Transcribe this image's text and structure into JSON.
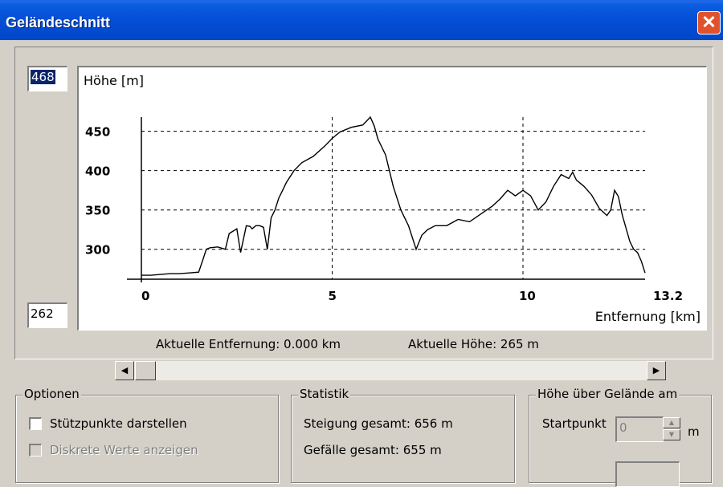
{
  "window": {
    "title": "Geländeschnitt",
    "close_label": "✕"
  },
  "range": {
    "max_value": "468",
    "min_value": "262"
  },
  "chart_data": {
    "type": "line",
    "ylabel": "Höhe [m]",
    "xlabel": "Entfernung [km]",
    "xlim": [
      0,
      13.2
    ],
    "ylim": [
      262,
      468
    ],
    "xticks": [
      "0",
      "5",
      "10",
      "13.2"
    ],
    "xtick_values": [
      0,
      5,
      10,
      13.2
    ],
    "yticks": [
      "300",
      "350",
      "400",
      "450"
    ],
    "ytick_values": [
      300,
      350,
      400,
      450
    ],
    "grid": true,
    "series": [
      {
        "x": [
          0,
          0.25,
          0.5,
          0.75,
          1,
          1.25,
          1.5,
          1.6,
          1.7,
          1.8,
          2,
          2.2,
          2.3,
          2.5,
          2.6,
          2.75,
          2.85,
          2.9,
          3.0,
          3.1,
          3.2,
          3.3,
          3.4,
          3.5,
          3.6,
          3.7,
          3.8,
          4.0,
          4.2,
          4.5,
          4.8,
          5.0,
          5.2,
          5.5,
          5.8,
          6.0,
          6.1,
          6.2,
          6.4,
          6.6,
          6.8,
          7.0,
          7.2,
          7.35,
          7.5,
          7.7,
          8.0,
          8.3,
          8.6,
          8.9,
          9.2,
          9.4,
          9.6,
          9.8,
          10.0,
          10.2,
          10.4,
          10.6,
          10.8,
          11.0,
          11.2,
          11.3,
          11.4,
          11.6,
          11.8,
          12.0,
          12.2,
          12.3,
          12.4,
          12.5,
          12.6,
          12.8,
          12.9,
          13.0,
          13.1,
          13.2
        ],
        "y": [
          267,
          267,
          268,
          269,
          269,
          270,
          271,
          285,
          300,
          302,
          303,
          300,
          320,
          326,
          296,
          330,
          329,
          326,
          330,
          330,
          328,
          300,
          340,
          350,
          365,
          375,
          385,
          400,
          410,
          418,
          431,
          441,
          449,
          455,
          458,
          468,
          457,
          440,
          420,
          380,
          350,
          330,
          300,
          318,
          325,
          330,
          330,
          338,
          335,
          345,
          355,
          364,
          375,
          368,
          375,
          368,
          350,
          360,
          380,
          395,
          390,
          398,
          388,
          380,
          369,
          352,
          343,
          350,
          375,
          367,
          344,
          310,
          300,
          296,
          285,
          270
        ]
      }
    ]
  },
  "readouts": {
    "distance": "Aktuelle Entfernung: 0.000 km",
    "height": "Aktuelle Höhe: 265 m"
  },
  "options": {
    "legend": "Optionen",
    "show_support_points": "Stützpunkte darstellen",
    "show_discrete_values": "Diskrete Werte anzeigen"
  },
  "statistics": {
    "legend": "Statistik",
    "ascent": "Steigung gesamt: 656 m",
    "descent": "Gefälle gesamt: 655 m"
  },
  "height_above_terrain": {
    "legend": "Höhe über Gelände am",
    "start_label": "Startpunkt",
    "start_value": "0",
    "unit": "m"
  }
}
